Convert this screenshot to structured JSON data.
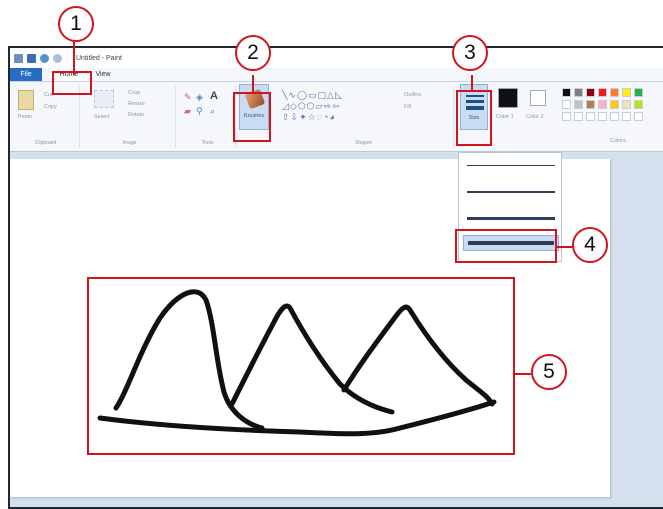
{
  "window": {
    "title": "Untitled - Paint"
  },
  "tabs": {
    "file": "File",
    "home": "Home",
    "view": "View"
  },
  "ribbon": {
    "clipboard": {
      "paste": "Paste",
      "cut": "Cut",
      "copy": "Copy",
      "label": "Clipboard"
    },
    "image": {
      "select": "Select",
      "crop": "Crop",
      "resize": "Resize",
      "rotate": "Rotate",
      "label": "Image"
    },
    "tools": {
      "label": "Tools"
    },
    "brushes": {
      "label": "Brushes"
    },
    "shapes": {
      "outline": "Outline",
      "fill": "Fill",
      "label": "Shapes"
    },
    "size": {
      "label": "Size"
    },
    "color1": {
      "label": "Color 1",
      "value": "#111111"
    },
    "color2": {
      "label": "Color 2",
      "value": "#ffffff"
    },
    "colors": {
      "label": "Colors"
    }
  },
  "palette": [
    "#111111",
    "#7f7f7f",
    "#880015",
    "#ed1c24",
    "#ff7f27",
    "#fff200",
    "#22b14c",
    "#ffffff",
    "#c3c3c3",
    "#b97a57",
    "#ffaec9",
    "#ffc90e",
    "#efe4b0",
    "#b5e61d"
  ],
  "size_options": [
    1,
    3,
    5,
    8
  ],
  "size_selected": 8,
  "callouts": [
    "1",
    "2",
    "3",
    "4",
    "5"
  ],
  "accent": "#d3141c"
}
